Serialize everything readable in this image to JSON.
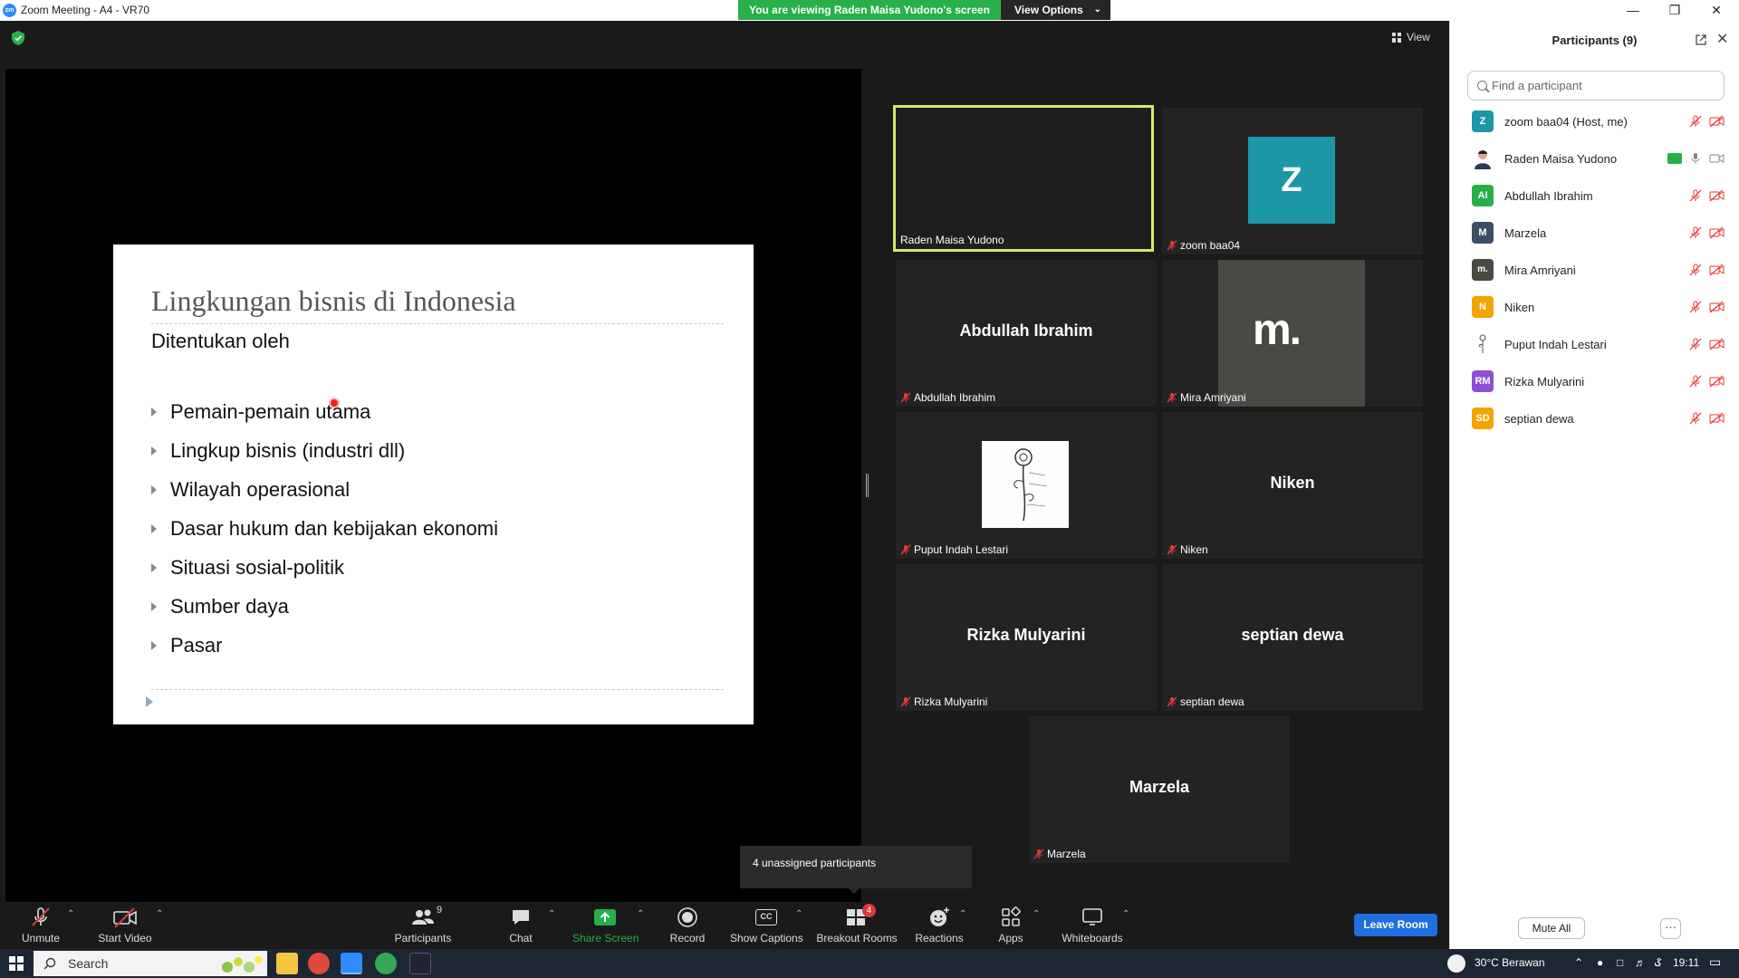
{
  "window": {
    "title": "Zoom Meeting - A4 - VR70",
    "logo": "zm"
  },
  "banner": {
    "viewing_text": "You are viewing Raden Maisa Yudono's screen",
    "view_options": "View Options"
  },
  "view_button": "View",
  "slide": {
    "title": "Lingkungan bisnis di Indonesia",
    "subtitle": "Ditentukan oleh",
    "bullets": [
      "Pemain-pemain utama",
      "Lingkup bisnis (industri dll)",
      "Wilayah operasional",
      "Dasar hukum dan kebijakan ekonomi",
      "Situasi sosial-politik",
      "Sumber daya",
      "Pasar"
    ]
  },
  "tiles": [
    {
      "label": "Raden Maisa Yudono",
      "big": "",
      "muted": false,
      "active": true
    },
    {
      "label": "zoom baa04",
      "big": "",
      "muted": true,
      "avatar": "Z"
    },
    {
      "label": "Abdullah Ibrahim",
      "big": "Abdullah Ibrahim",
      "muted": true
    },
    {
      "label": "Mira Amriyani",
      "big": "",
      "muted": true,
      "avatar": "m."
    },
    {
      "label": "Puput Indah Lestari",
      "big": "",
      "muted": true
    },
    {
      "label": "Niken",
      "big": "Niken",
      "muted": true
    },
    {
      "label": "Rizka Mulyarini",
      "big": "Rizka Mulyarini",
      "muted": true
    },
    {
      "label": "septian dewa",
      "big": "septian dewa",
      "muted": true
    },
    {
      "label": "Marzela",
      "big": "Marzela",
      "muted": true
    }
  ],
  "tooltip": "4 unassigned participants",
  "toolbar": {
    "unmute": "Unmute",
    "start_video": "Start Video",
    "participants": "Participants",
    "participants_count": "9",
    "chat": "Chat",
    "share_screen": "Share Screen",
    "record": "Record",
    "show_captions": "Show Captions",
    "captions_icon": "CC",
    "breakout_rooms": "Breakout Rooms",
    "breakout_badge": "4",
    "reactions": "Reactions",
    "apps": "Apps",
    "whiteboards": "Whiteboards",
    "leave": "Leave Room"
  },
  "panel": {
    "title": "Participants (9)",
    "search_placeholder": "Find a participant",
    "participants": [
      {
        "initials": "Z",
        "name": "zoom baa04 (Host, me)",
        "color": "#1b97a8",
        "mic": "off",
        "cam": "off"
      },
      {
        "initials": "",
        "name": "Raden Maisa Yudono",
        "color": "#f0d6c8",
        "mic": "on",
        "cam": "on",
        "sharing": true
      },
      {
        "initials": "AI",
        "name": "Abdullah Ibrahim",
        "color": "#27b04a",
        "mic": "off",
        "cam": "off"
      },
      {
        "initials": "M",
        "name": "Marzela",
        "color": "#3d4d66",
        "mic": "off",
        "cam": "off"
      },
      {
        "initials": "m.",
        "name": "Mira Amriyani",
        "color": "#4a4a45",
        "mic": "off",
        "cam": "off"
      },
      {
        "initials": "N",
        "name": "Niken",
        "color": "#f5a300",
        "mic": "off",
        "cam": "off"
      },
      {
        "initials": "",
        "name": "Puput Indah Lestari",
        "color": "#eeeeee",
        "mic": "off",
        "cam": "off"
      },
      {
        "initials": "RM",
        "name": "Rizka Mulyarini",
        "color": "#8e4fd6",
        "mic": "off",
        "cam": "off"
      },
      {
        "initials": "SD",
        "name": "septian dewa",
        "color": "#f5a300",
        "mic": "off",
        "cam": "off"
      }
    ],
    "mute_all": "Mute All",
    "more": "···"
  },
  "taskbar": {
    "search": "Search",
    "weather": "30°C  Berawan",
    "time": "19:11"
  },
  "colors": {
    "active_speaker": "#d6e86a",
    "share_green": "#27b04a",
    "leave_blue": "#1f6fe0",
    "muted_red": "#e03a3a"
  }
}
